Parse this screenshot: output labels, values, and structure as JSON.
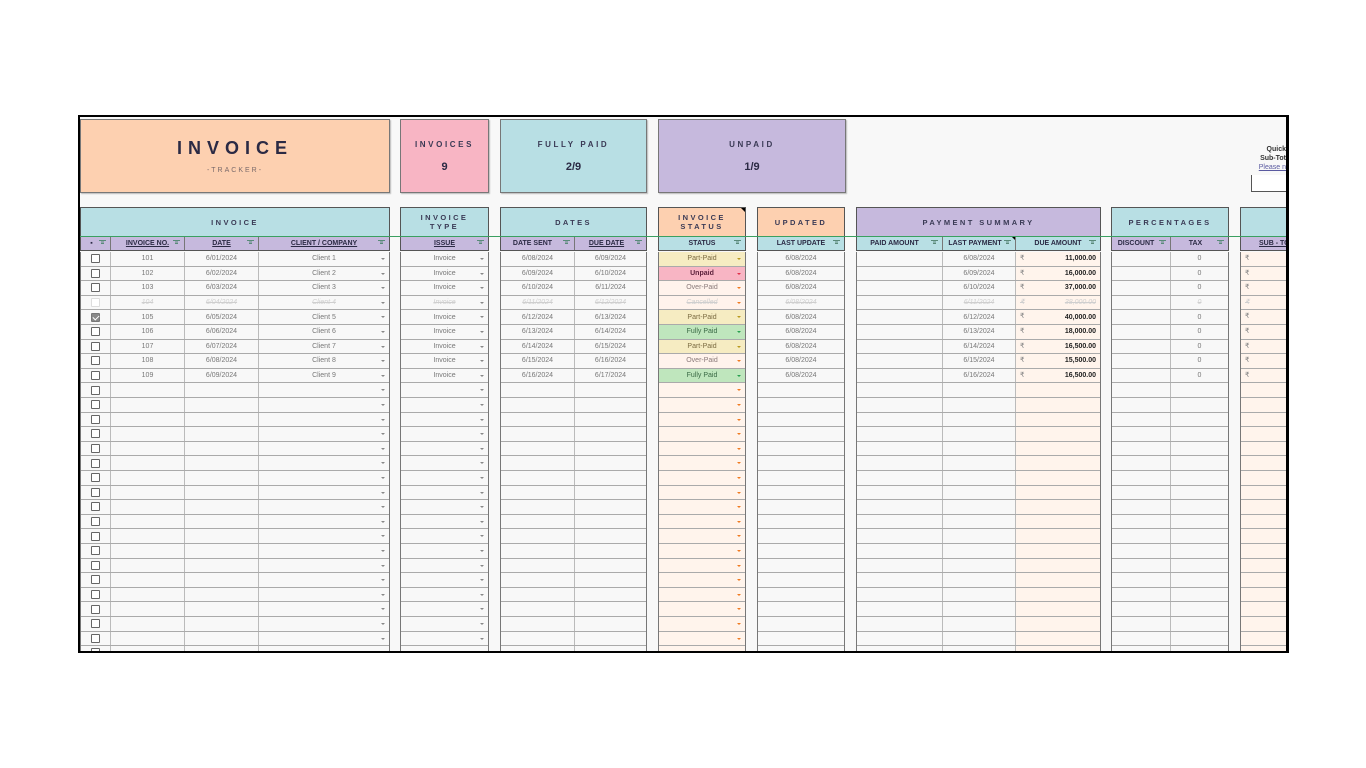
{
  "summary": {
    "title": "INVOICE",
    "subtitle": "-TRACKER-",
    "invoices": {
      "label": "INVOICES",
      "value": "9"
    },
    "fully_paid": {
      "label": "FULLY PAID",
      "value": "2/9"
    },
    "unpaid": {
      "label": "UNPAID",
      "value": "1/9"
    },
    "quick": {
      "line1": "Quick",
      "line2": "Sub-Tot",
      "link": "Please n"
    }
  },
  "colors": {
    "peach": "#fdd0b0",
    "pink": "#f8b5c4",
    "teal": "#b8dfe4",
    "lavender": "#c6b9dd",
    "part_paid": "#f6ecc2",
    "unpaid": "#f8b5c4",
    "over_paid": "#fff3ec",
    "fully_paid": "#bfe6bd"
  },
  "groups": {
    "invoice": "INVOICE",
    "invoice_type": "INVOICE TYPE",
    "dates": "DATES",
    "invoice_status": "INVOICE STATUS",
    "updated": "UPDATED",
    "payment_summary": "PAYMENT SUMMARY",
    "percentages": "PERCENTAGES"
  },
  "headers": {
    "select": "",
    "invoice_no": "INVOICE NO.",
    "date": "DATE",
    "client": "CLIENT / COMPANY",
    "issue": "ISSUE",
    "date_sent": "DATE SENT",
    "due_date": "DUE DATE",
    "status": "STATUS",
    "last_update": "LAST UPDATE",
    "paid_amount": "PAID AMOUNT",
    "last_payment": "LAST PAYMENT",
    "due_amount": "DUE AMOUNT",
    "discount": "DISCOUNT",
    "tax": "TAX",
    "sub_total": "SUB - TOT"
  },
  "currency_symbol": "₹",
  "rows": [
    {
      "checked": false,
      "cancelled": false,
      "invoice_no": "101",
      "date": "6/01/2024",
      "client": "Client 1",
      "issue": "Invoice",
      "date_sent": "6/08/2024",
      "due_date": "6/09/2024",
      "status": "Part-Paid",
      "last_update": "6/08/2024",
      "paid_amount": "",
      "last_payment": "6/08/2024",
      "due_amount": "11,000.00",
      "discount": "",
      "tax": "0"
    },
    {
      "checked": false,
      "cancelled": false,
      "invoice_no": "102",
      "date": "6/02/2024",
      "client": "Client 2",
      "issue": "Invoice",
      "date_sent": "6/09/2024",
      "due_date": "6/10/2024",
      "status": "Unpaid",
      "last_update": "6/08/2024",
      "paid_amount": "",
      "last_payment": "6/09/2024",
      "due_amount": "16,000.00",
      "discount": "",
      "tax": "0"
    },
    {
      "checked": false,
      "cancelled": false,
      "invoice_no": "103",
      "date": "6/03/2024",
      "client": "Client 3",
      "issue": "Invoice",
      "date_sent": "6/10/2024",
      "due_date": "6/11/2024",
      "status": "Over-Paid",
      "last_update": "6/08/2024",
      "paid_amount": "",
      "last_payment": "6/10/2024",
      "due_amount": "37,000.00",
      "discount": "",
      "tax": "0"
    },
    {
      "checked": false,
      "cancelled": true,
      "invoice_no": "104",
      "date": "6/04/2024",
      "client": "Client 4",
      "issue": "Invoice",
      "date_sent": "6/11/2024",
      "due_date": "6/12/2024",
      "status": "Cancelled",
      "last_update": "6/08/2024",
      "paid_amount": "",
      "last_payment": "6/11/2024",
      "due_amount": "38,000.00",
      "discount": "",
      "tax": "0"
    },
    {
      "checked": true,
      "cancelled": false,
      "invoice_no": "105",
      "date": "6/05/2024",
      "client": "Client 5",
      "issue": "Invoice",
      "date_sent": "6/12/2024",
      "due_date": "6/13/2024",
      "status": "Part-Paid",
      "last_update": "6/08/2024",
      "paid_amount": "",
      "last_payment": "6/12/2024",
      "due_amount": "40,000.00",
      "discount": "",
      "tax": "0"
    },
    {
      "checked": false,
      "cancelled": false,
      "invoice_no": "106",
      "date": "6/06/2024",
      "client": "Client 6",
      "issue": "Invoice",
      "date_sent": "6/13/2024",
      "due_date": "6/14/2024",
      "status": "Fully Paid",
      "last_update": "6/08/2024",
      "paid_amount": "",
      "last_payment": "6/13/2024",
      "due_amount": "18,000.00",
      "discount": "",
      "tax": "0"
    },
    {
      "checked": false,
      "cancelled": false,
      "invoice_no": "107",
      "date": "6/07/2024",
      "client": "Client 7",
      "issue": "Invoice",
      "date_sent": "6/14/2024",
      "due_date": "6/15/2024",
      "status": "Part-Paid",
      "last_update": "6/08/2024",
      "paid_amount": "",
      "last_payment": "6/14/2024",
      "due_amount": "16,500.00",
      "discount": "",
      "tax": "0"
    },
    {
      "checked": false,
      "cancelled": false,
      "invoice_no": "108",
      "date": "6/08/2024",
      "client": "Client 8",
      "issue": "Invoice",
      "date_sent": "6/15/2024",
      "due_date": "6/16/2024",
      "status": "Over-Paid",
      "last_update": "6/08/2024",
      "paid_amount": "",
      "last_payment": "6/15/2024",
      "due_amount": "15,500.00",
      "discount": "",
      "tax": "0"
    },
    {
      "checked": false,
      "cancelled": false,
      "invoice_no": "109",
      "date": "6/09/2024",
      "client": "Client 9",
      "issue": "Invoice",
      "date_sent": "6/16/2024",
      "due_date": "6/17/2024",
      "status": "Fully Paid",
      "last_update": "6/08/2024",
      "paid_amount": "",
      "last_payment": "6/16/2024",
      "due_amount": "16,500.00",
      "discount": "",
      "tax": "0"
    }
  ],
  "empty_row_count": 19
}
